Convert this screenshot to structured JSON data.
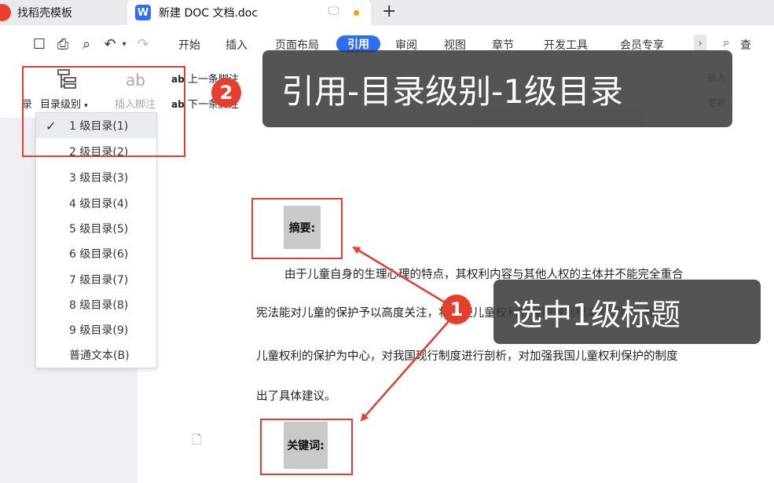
{
  "tabs": [
    {
      "label": "找稻壳模板"
    },
    {
      "label": "新建 DOC 文档.doc"
    }
  ],
  "menu": {
    "items": [
      "开始",
      "插入",
      "页面布局",
      "引用",
      "审阅",
      "视图",
      "章节",
      "开发工具",
      "会员专享"
    ],
    "active": "引用",
    "search_label": "查"
  },
  "ribbon": {
    "left_cut": "录",
    "toc_level": "目录级别",
    "insert_footnote": "插入脚注",
    "prev_footnote": "上一条脚注",
    "next_footnote": "下一条脚注",
    "right_1": "插入",
    "right_2": "更新"
  },
  "dropdown": {
    "items": [
      "1 级目录(1)",
      "2 级目录(2)",
      "3 级目录(3)",
      "4 级目录(4)",
      "5 级目录(5)",
      "6 级目录(6)",
      "7 级目录(7)",
      "8 级目录(8)",
      "9 级目录(9)",
      "普通文本(B)"
    ],
    "checked_index": 0
  },
  "document": {
    "abstract_heading": "摘要:",
    "paragraph_lines": [
      "由于儿童自身的生理心理的特点，其权利内容与其他人权的主体并不能完全重合",
      "宪法能对儿童的保护予以高度关注，将会使儿童权利的保护得到根本的保障。我国",
      "儿童权利的保护为中心，对我国现行制度进行剖析，对加强我国儿童权利保护的制度",
      "出了具体建议。"
    ],
    "keywords_heading": "关键词:"
  },
  "callouts": {
    "step2_number": "2",
    "step2_text": "引用-目录级别-1级目录",
    "step1_number": "1",
    "step1_text": "选中1级标题"
  },
  "colors": {
    "accent_blue": "#2e6ef4",
    "annotation_red": "#e5402f",
    "callout_bg": "#3c3c3c"
  }
}
